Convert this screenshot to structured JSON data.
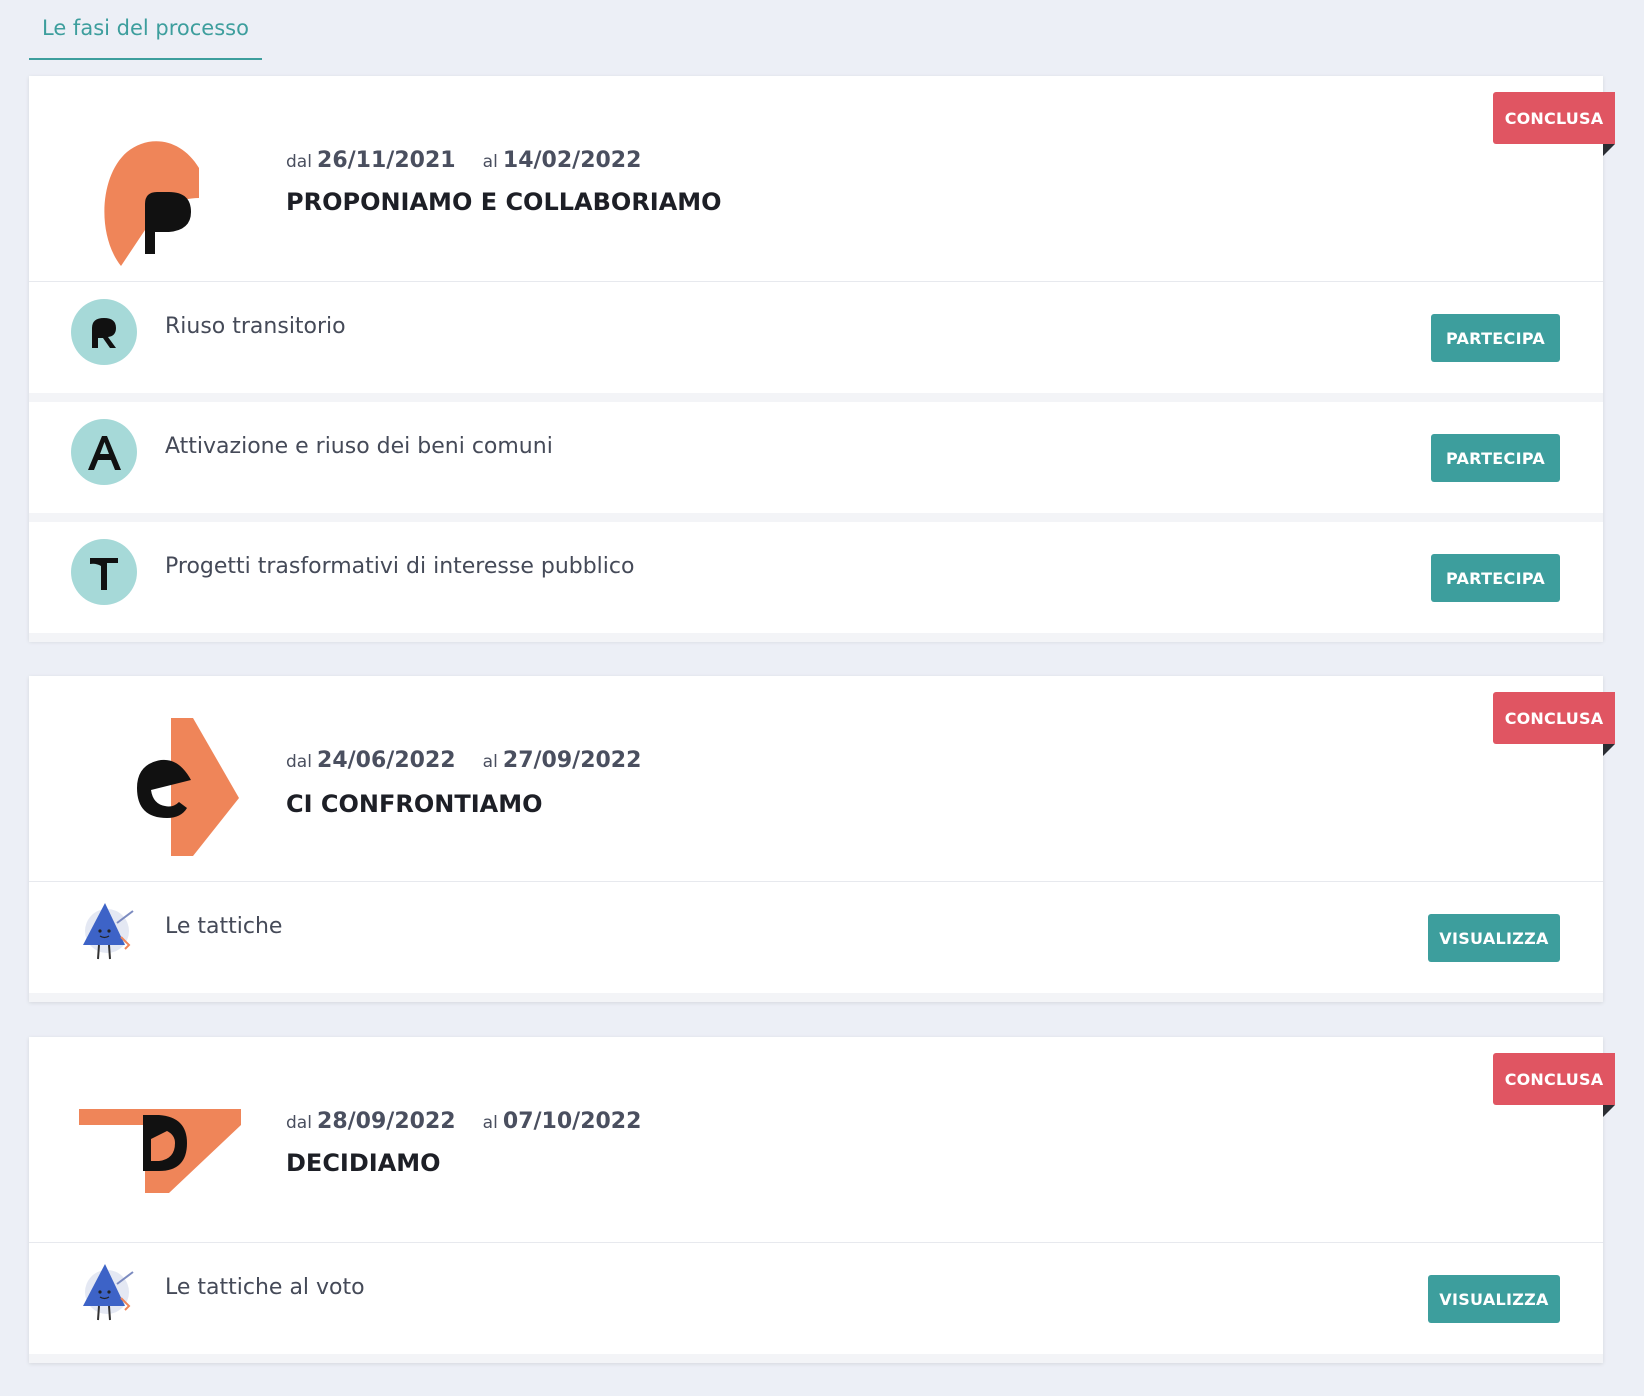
{
  "tabs": {
    "active_label": "Le fasi del processo"
  },
  "colors": {
    "accent": "#3d9e9d",
    "status": "#e05562",
    "logo_orange": "#ef8559",
    "icon_bg": "#a6d9d8"
  },
  "phases": [
    {
      "logo": "phase-p-icon",
      "date_from_prefix": "dal",
      "date_from": "26/11/2021",
      "date_to_prefix": "al",
      "date_to": "14/02/2022",
      "title": "PROPONIAMO E COLLABORIAMO",
      "status": "CONCLUSA",
      "items": [
        {
          "icon": "letter-r-icon",
          "label": "Riuso transitorio",
          "action": "PARTECIPA"
        },
        {
          "icon": "letter-a-icon",
          "label": "Attivazione e riuso dei beni comuni",
          "action": "PARTECIPA"
        },
        {
          "icon": "letter-t-icon",
          "label": "Progetti trasformativi di interesse pubblico",
          "action": "PARTECIPA"
        }
      ]
    },
    {
      "logo": "phase-c-icon",
      "date_from_prefix": "dal",
      "date_from": "24/06/2022",
      "date_to_prefix": "al",
      "date_to": "27/09/2022",
      "title": "CI CONFRONTIAMO",
      "status": "CONCLUSA",
      "items": [
        {
          "icon": "mascot-icon",
          "label": "Le tattiche",
          "action": "VISUALIZZA"
        }
      ]
    },
    {
      "logo": "phase-d-icon",
      "date_from_prefix": "dal",
      "date_from": "28/09/2022",
      "date_to_prefix": "al",
      "date_to": "07/10/2022",
      "title": "DECIDIAMO",
      "status": "CONCLUSA",
      "items": [
        {
          "icon": "mascot-icon",
          "label": "Le tattiche al voto",
          "action": "VISUALIZZA"
        }
      ]
    }
  ]
}
